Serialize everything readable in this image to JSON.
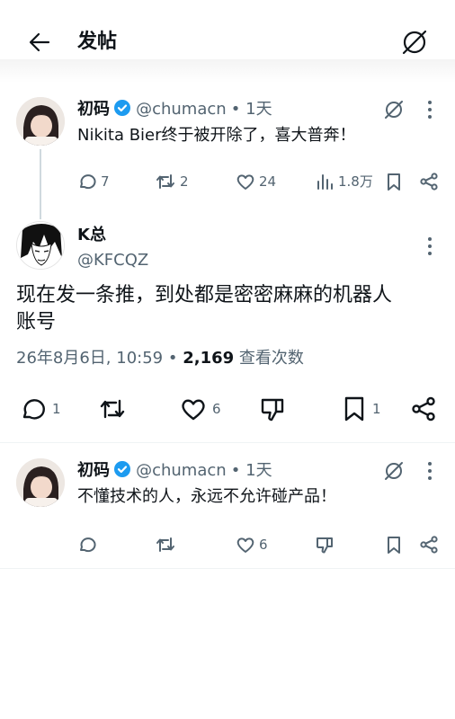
{
  "header": {
    "title": "发帖",
    "back_icon": "back-arrow-icon",
    "grok_icon": "grok-slash-icon"
  },
  "tweet1": {
    "name": "初码",
    "handle": "@chumacn",
    "time": "• 1天",
    "text": "Nikita Bier终于被开除了，喜大普奔！",
    "replies": "7",
    "retweets": "2",
    "likes": "24",
    "views": "1.8万"
  },
  "main": {
    "name": "K总",
    "handle": "@KFCQZ",
    "text_line1": "现在发一条推，到处都是密密麻麻的机器人",
    "text_line2": "账号",
    "meta_date": "26年8月6日, 10:59 •",
    "meta_views": "2,169",
    "meta_views_label": "查看次数",
    "replies": "1",
    "likes": "6",
    "bookmarks": "1"
  },
  "tweet2": {
    "name": "初码",
    "handle": "@chumacn",
    "time": "• 1天",
    "text": "不懂技术的人，永远不允许碰产品！",
    "likes": "6"
  },
  "colors": {
    "verified": "#1d9bf0",
    "muted": "#536471",
    "text": "#0f1419",
    "divider": "#eff3f4"
  }
}
